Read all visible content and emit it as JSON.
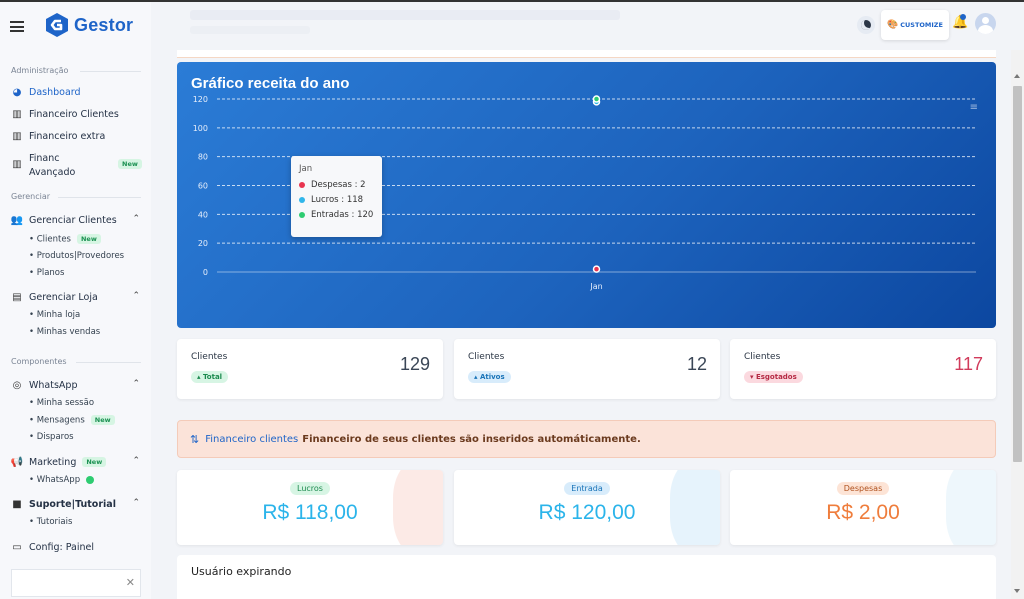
{
  "brand": {
    "name": "Gestor"
  },
  "sidebar": {
    "sections": {
      "administracao": "Administração",
      "gerenciar": "Gerenciar",
      "componentes": "Componentes"
    },
    "items": {
      "dashboard": "Dashboard",
      "financeiro_clientes": "Financeiro Clientes",
      "financeiro_extra": "Financeiro extra",
      "financ_avancado_1": "Financ",
      "financ_avancado_2": "Avançado",
      "gerenciar_clientes": "Gerenciar Clientes",
      "gerenciar_loja": "Gerenciar Loja",
      "whatsapp": "WhatsApp",
      "marketing": "Marketing",
      "suporte": "Suporte|Tutorial",
      "config": "Config: Painel"
    },
    "subitems": {
      "clientes": "• Clientes",
      "produtos": "• Produtos|Provedores",
      "planos": "• Planos",
      "minha_loja": "• Minha loja",
      "minhas_vendas": "• Minhas vendas",
      "minha_sessao": "• Minha sessão",
      "mensagens": "• Mensagens",
      "disparos": "• Disparos",
      "mk_whatsapp": "• WhatsApp",
      "tutoriais": "• Tutoriais"
    },
    "badge_new": "New"
  },
  "header": {
    "customize": "CUSTOMIZE"
  },
  "chart_card": {
    "title": "Gráfico receita do ano"
  },
  "chart_data": {
    "type": "line",
    "title": "Gráfico receita do ano",
    "categories": [
      "Jan"
    ],
    "series": [
      {
        "name": "Despesas",
        "values": [
          2
        ],
        "color": "#e8344f"
      },
      {
        "name": "Lucros",
        "values": [
          118
        ],
        "color": "#30b6ea"
      },
      {
        "name": "Entradas",
        "values": [
          120
        ],
        "color": "#2ecc71"
      }
    ],
    "yticks": [
      "120",
      "100",
      "80",
      "60",
      "40",
      "20",
      "0"
    ],
    "ylim": [
      0,
      120
    ],
    "grid": true
  },
  "tooltip": {
    "title": "Jan",
    "rows": [
      "Despesas : 2",
      "Lucros : 118",
      "Entradas : 120"
    ]
  },
  "stats": [
    {
      "label": "Clientes",
      "value": "129",
      "pill": "Total"
    },
    {
      "label": "Clientes",
      "value": "12",
      "pill": "Ativos"
    },
    {
      "label": "Clientes",
      "value": "117",
      "pill": "Esgotados"
    }
  ],
  "alert": {
    "link": "Financeiro clientes",
    "text": "Financeiro de seus clientes são inseridos automáticamente."
  },
  "money": [
    {
      "label": "Lucros",
      "value": "R$ 118,00",
      "color": "#2bb4ea"
    },
    {
      "label": "Entrada",
      "value": "R$ 120,00",
      "color": "#2bb4ea"
    },
    {
      "label": "Despesas",
      "value": "R$ 2,00",
      "color": "#ef7d3c"
    }
  ],
  "users_card": {
    "title": "Usuário expirando"
  }
}
